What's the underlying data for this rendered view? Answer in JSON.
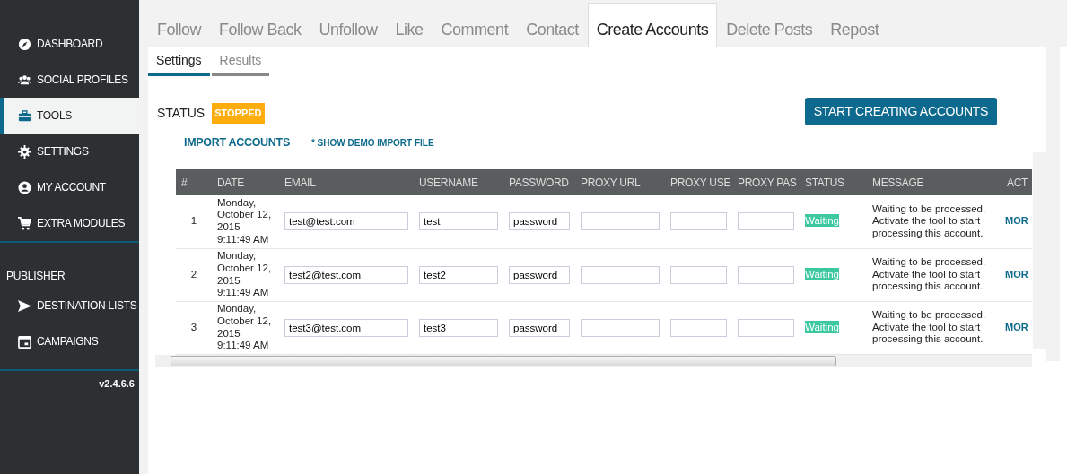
{
  "sidebar": {
    "items": [
      {
        "label": "DASHBOARD",
        "selected": false
      },
      {
        "label": "SOCIAL PROFILES",
        "selected": false
      },
      {
        "label": "TOOLS",
        "selected": true
      },
      {
        "label": "SETTINGS",
        "selected": false
      },
      {
        "label": "MY ACCOUNT",
        "selected": false
      },
      {
        "label": "EXTRA MODULES",
        "selected": false
      }
    ],
    "section_title": "PUBLISHER",
    "publisher_items": [
      {
        "label": "DESTINATION LISTS",
        "selected": false
      },
      {
        "label": "CAMPAIGNS",
        "selected": false
      }
    ],
    "version": "v2.4.6.6"
  },
  "tabs": [
    {
      "label": "Follow",
      "selected": false
    },
    {
      "label": "Follow Back",
      "selected": false
    },
    {
      "label": "Unfollow",
      "selected": false
    },
    {
      "label": "Like",
      "selected": false
    },
    {
      "label": "Comment",
      "selected": false
    },
    {
      "label": "Contact",
      "selected": false
    },
    {
      "label": "Create Accounts",
      "selected": true
    },
    {
      "label": "Delete Posts",
      "selected": false
    },
    {
      "label": "Repost",
      "selected": false
    }
  ],
  "subtabs": [
    {
      "label": "Settings",
      "selected": true
    },
    {
      "label": "Results",
      "selected": false
    }
  ],
  "status": {
    "label": "STATUS",
    "value": "STOPPED"
  },
  "start_button": "START CREATING ACCOUNTS",
  "import_link": "IMPORT ACCOUNTS",
  "demo_link": "* SHOW DEMO IMPORT FILE",
  "table": {
    "columns": [
      "#",
      "DATE",
      "EMAIL",
      "USERNAME",
      "PASSWORD",
      "PROXY URL",
      "PROXY USE",
      "PROXY PAS",
      "STATUS",
      "MESSAGE",
      "ACT"
    ],
    "rows": [
      {
        "index": "1",
        "date": "Monday, October 12, 2015 9:11:49 AM",
        "email": "test@test.com",
        "username": "test",
        "password": "password",
        "status": "Waiting",
        "message": "Waiting to be processed. Activate the tool to start processing this account.",
        "action": "MOR"
      },
      {
        "index": "2",
        "date": "Monday, October 12, 2015 9:11:49 AM",
        "email": "test2@test.com",
        "username": "test2",
        "password": "password",
        "status": "Waiting",
        "message": "Waiting to be processed. Activate the tool to start processing this account.",
        "action": "MOR"
      },
      {
        "index": "3",
        "date": "Monday, October 12, 2015 9:11:49 AM",
        "email": "test3@test.com",
        "username": "test3",
        "password": "password",
        "status": "Waiting",
        "message": "Waiting to be processed. Activate the tool to start processing this account.",
        "action": "MOR"
      }
    ]
  }
}
